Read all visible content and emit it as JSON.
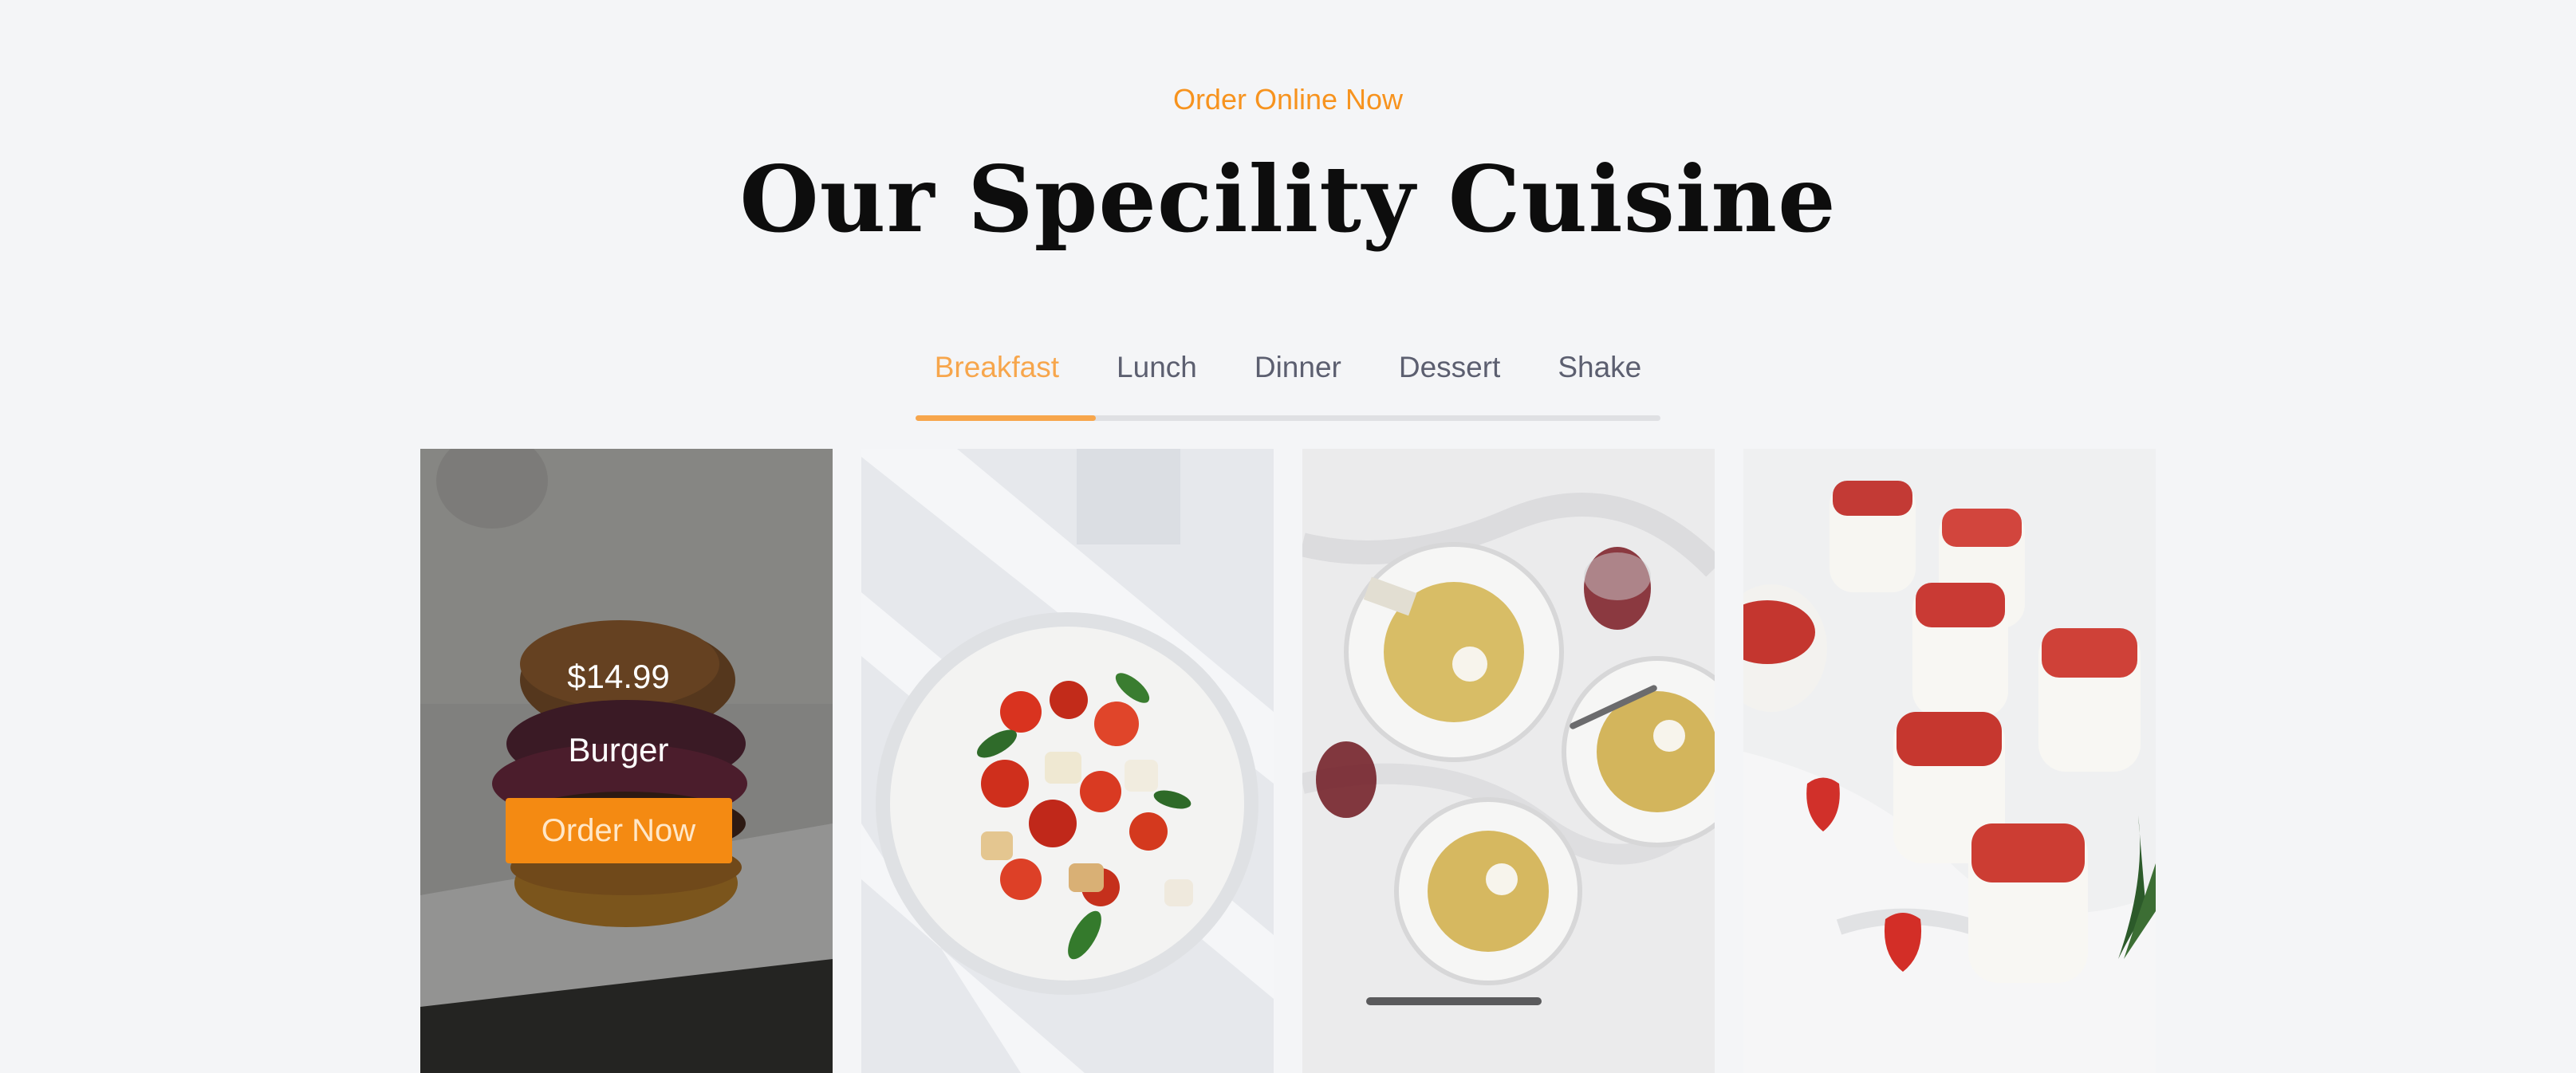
{
  "header": {
    "kicker": "Order Online Now",
    "title": "Our Specility Cuisine"
  },
  "tabs": [
    {
      "label": "Breakfast",
      "active": true
    },
    {
      "label": "Lunch",
      "active": false
    },
    {
      "label": "Dinner",
      "active": false
    },
    {
      "label": "Dessert",
      "active": false
    },
    {
      "label": "Shake",
      "active": false
    }
  ],
  "cards": [
    {
      "image": "burger-photo",
      "price": "$14.99",
      "name": "Burger",
      "button_label": "Order Now"
    },
    {
      "image": "caprese-salad-photo"
    },
    {
      "image": "spaghetti-plates-photo"
    },
    {
      "image": "strawberry-panna-cotta-photo"
    }
  ],
  "colors": {
    "accent": "#f7931e",
    "tab_active": "#f7a64c",
    "button": "#f48a12",
    "background": "#f4f5f7"
  }
}
